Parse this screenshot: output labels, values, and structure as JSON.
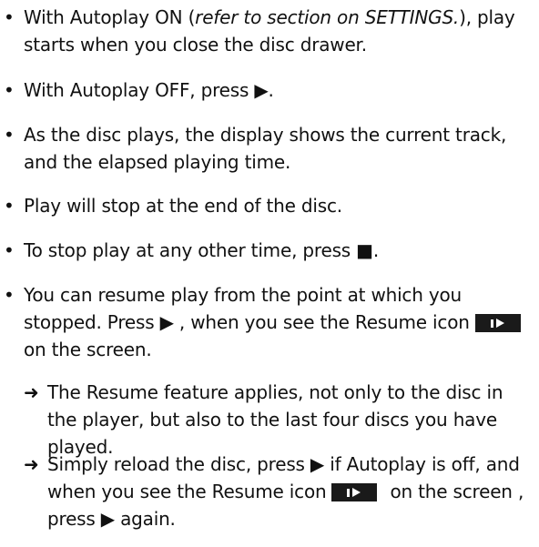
{
  "bullets": [
    {
      "pre": "With Autoplay ON (",
      "italic": "refer to section on SETTINGS.",
      "post": "), play starts when you close the disc drawer."
    },
    {
      "text": "With Autoplay OFF, press ▶."
    },
    {
      "text": "As the disc plays, the display shows the current track, and the elapsed playing time."
    },
    {
      "text": "Play will stop at the end of the disc."
    },
    {
      "text": "To stop play at any other time, press ■."
    },
    {
      "pre": "You can resume play from the point at which you stopped. Press ▶ , when you see the Resume icon",
      "post": "on the screen."
    }
  ],
  "sub_items": [
    {
      "text": "The Resume feature applies, not only to the disc in the player, but also to the last four discs you have played."
    },
    {
      "pre": "Simply reload the disc, press ▶ if Autoplay is off, and when you see the Resume icon",
      "post": "on the screen , press ▶ again."
    }
  ],
  "symbols": {
    "bullet": "•",
    "arrow": "➜"
  },
  "icons": {
    "resume": "resume-icon"
  }
}
